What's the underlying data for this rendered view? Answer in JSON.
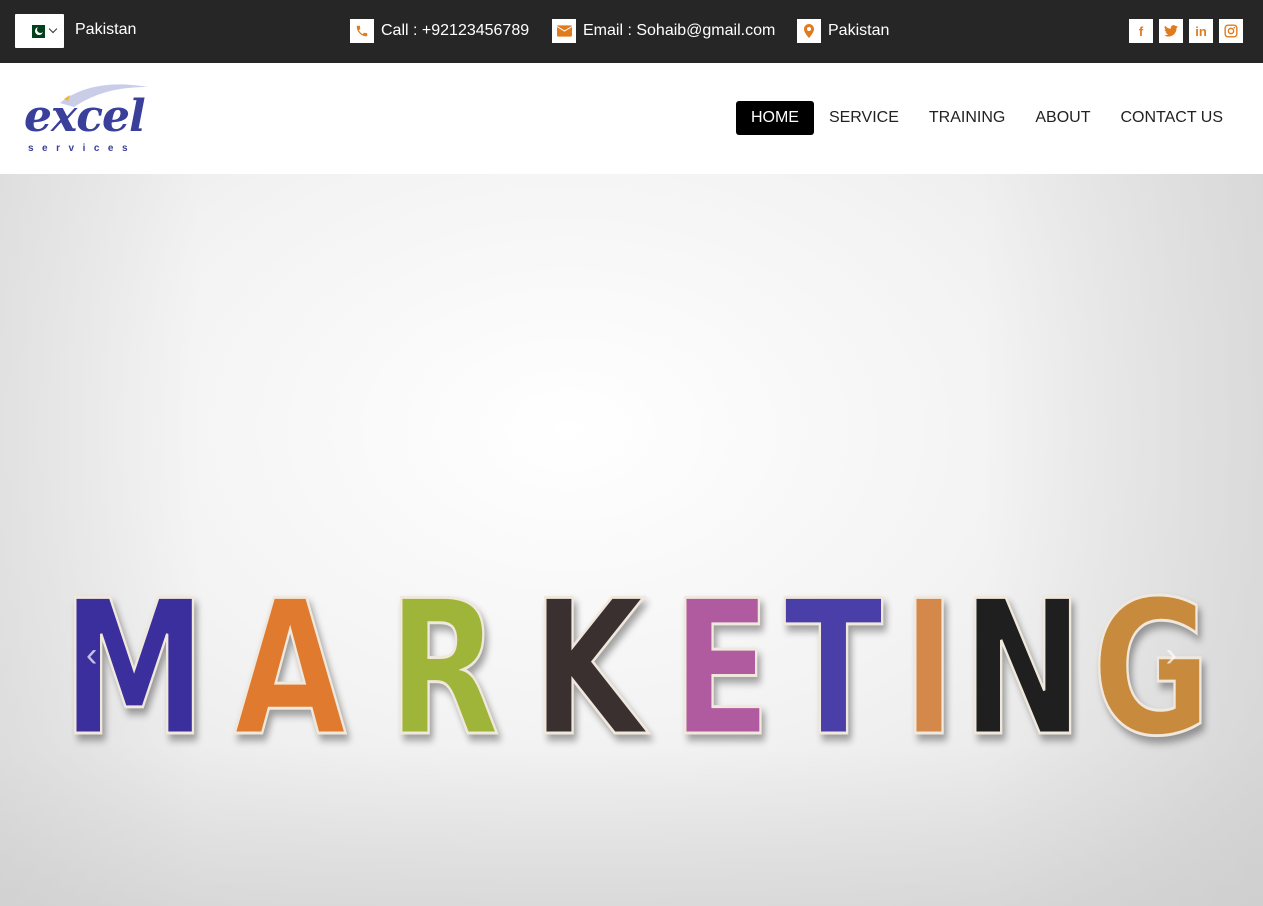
{
  "topbar": {
    "country": {
      "selected": "Pakistan",
      "flag_icon": "pakistan-flag-icon"
    },
    "phone": {
      "label": "Call : +92123456789",
      "icon": "phone-icon"
    },
    "email": {
      "label": "Email : Sohaib@gmail.com",
      "icon": "envelope-icon"
    },
    "location": {
      "label": "Pakistan",
      "icon": "map-pin-icon"
    },
    "socials": [
      {
        "name": "facebook",
        "glyph": "f"
      },
      {
        "name": "twitter",
        "glyph": "t"
      },
      {
        "name": "linkedin",
        "glyph": "in"
      },
      {
        "name": "instagram",
        "glyph": "◎"
      }
    ],
    "icon_color": "#e07b1e",
    "background": "#262626"
  },
  "header": {
    "logo": {
      "word": "excel",
      "sub": "services",
      "color": "#3a3f9a"
    },
    "nav": [
      {
        "label": "HOME",
        "active": true
      },
      {
        "label": "SERVICE",
        "active": false
      },
      {
        "label": "TRAINING",
        "active": false
      },
      {
        "label": "ABOUT",
        "active": false
      },
      {
        "label": "CONTACT US",
        "active": false
      }
    ]
  },
  "hero": {
    "word": "MARKETING",
    "letters": [
      {
        "ch": "M",
        "color": "#3b2f9e"
      },
      {
        "ch": "A",
        "color": "#e07a2e"
      },
      {
        "ch": "R",
        "color": "#9fb53a"
      },
      {
        "ch": "K",
        "color": "#3a3030"
      },
      {
        "ch": "E",
        "color": "#b05aa0"
      },
      {
        "ch": "T",
        "color": "#4a3fa8"
      },
      {
        "ch": "I",
        "color": "#d4884a"
      },
      {
        "ch": "N",
        "color": "#1f1f1f"
      },
      {
        "ch": "G",
        "color": "#c88a3c"
      }
    ],
    "prev_icon": "chevron-left-icon",
    "next_icon": "chevron-right-icon"
  }
}
